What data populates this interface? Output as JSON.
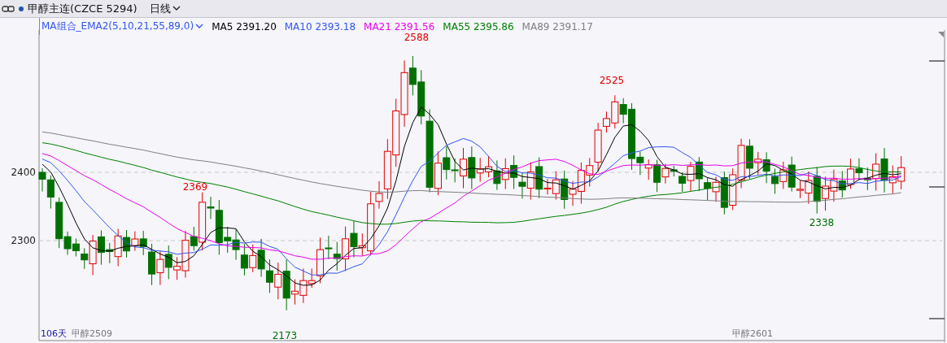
{
  "header": {
    "title": "甲醇主连(CZCE 5294)",
    "period": "日线"
  },
  "legend": {
    "indicator": "MA组合_EMA2(5,10,21,55,89,0)",
    "items": [
      {
        "label": "MA5 2391.20",
        "color": "#000000"
      },
      {
        "label": "MA10 2393.18",
        "color": "#3355ee"
      },
      {
        "label": "MA21 2391.56",
        "color": "#ee00ee"
      },
      {
        "label": "MA55 2395.86",
        "color": "#008000"
      },
      {
        "label": "MA89 2391.17",
        "color": "#808080"
      }
    ]
  },
  "y_axis_labels": [
    "2400",
    "2300"
  ],
  "price_marks": [
    {
      "text": "2588",
      "kind": "high"
    },
    {
      "text": "2525",
      "kind": "high"
    },
    {
      "text": "2369",
      "kind": "high"
    },
    {
      "text": "2173",
      "kind": "low"
    },
    {
      "text": "2338",
      "kind": "low"
    }
  ],
  "bottom": {
    "days": "106天",
    "contract_start": "甲醇2509",
    "contract_next": "甲醇2601"
  }
}
